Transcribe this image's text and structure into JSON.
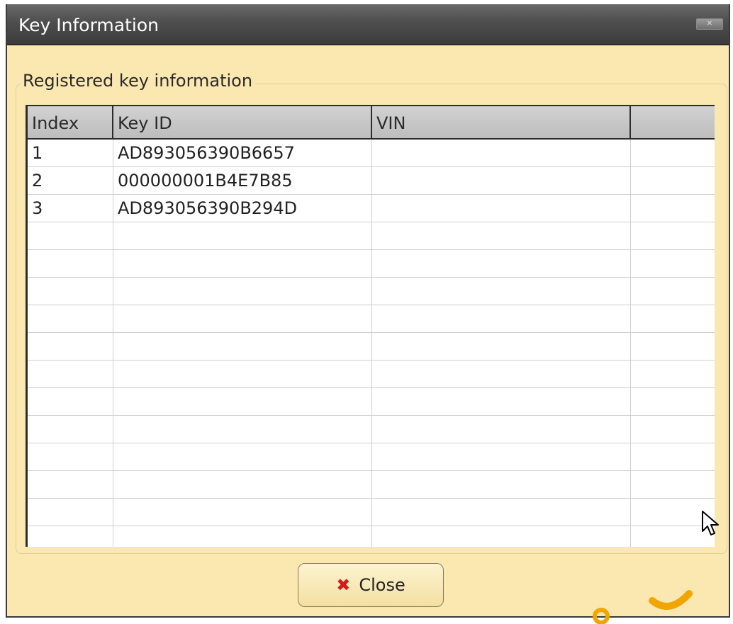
{
  "window": {
    "title": "Key Information"
  },
  "group": {
    "legend": "Registered key information"
  },
  "grid": {
    "columns": [
      "Index",
      "Key ID",
      "VIN",
      ""
    ],
    "rows": [
      [
        "1",
        "AD893056390B6657",
        "",
        ""
      ],
      [
        "2",
        "000000001B4E7B85",
        "",
        ""
      ],
      [
        "3",
        "AD893056390B294D",
        "",
        ""
      ],
      [
        "",
        "",
        "",
        ""
      ],
      [
        "",
        "",
        "",
        ""
      ],
      [
        "",
        "",
        "",
        ""
      ],
      [
        "",
        "",
        "",
        ""
      ],
      [
        "",
        "",
        "",
        ""
      ],
      [
        "",
        "",
        "",
        ""
      ],
      [
        "",
        "",
        "",
        ""
      ],
      [
        "",
        "",
        "",
        ""
      ],
      [
        "",
        "",
        "",
        ""
      ],
      [
        "",
        "",
        "",
        ""
      ],
      [
        "",
        "",
        "",
        ""
      ],
      [
        "",
        "",
        "",
        ""
      ]
    ]
  },
  "buttons": {
    "close_label": "Close",
    "close_icon": "red-x-icon"
  },
  "colors": {
    "window_bg": "#fbe8b0",
    "titlebar": "#4e4e4e",
    "close_icon": "#d41a1a",
    "watermark": "#f0a500"
  }
}
